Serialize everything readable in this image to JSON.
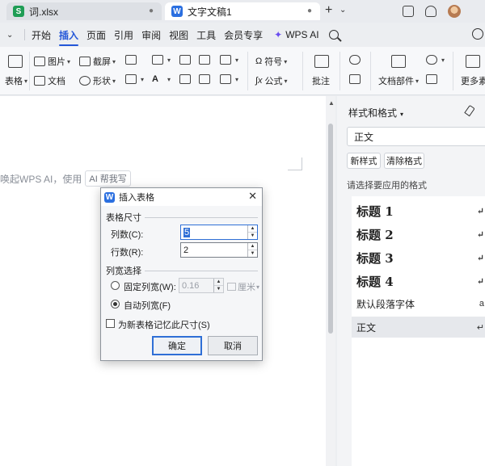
{
  "titlebar": {
    "tabs": [
      {
        "badge": "S",
        "label": "词.xlsx",
        "marker": "●"
      },
      {
        "badge": "W",
        "label": "文字文稿1",
        "marker": "●"
      }
    ],
    "new_tab": "+",
    "tab_list": "⌄"
  },
  "menubar": {
    "items": [
      "开始",
      "插入",
      "页面",
      "引用",
      "审阅",
      "视图",
      "工具",
      "会员专享"
    ],
    "active": "插入",
    "wps_ai": "WPS AI",
    "chevron": "⌄"
  },
  "ribbon": {
    "table": "表格",
    "picture": "图片",
    "screenshot": "截屏",
    "document": "文档",
    "shape": "形状",
    "symbol": "符号",
    "formula": "公式",
    "comment": "批注",
    "doc_parts": "文档部件",
    "more": "更多素"
  },
  "document": {
    "hint_text": "唤起WPS AI，使用",
    "ai_pill": "AI 帮我写"
  },
  "side_pane": {
    "title": "样式和格式",
    "current_style": "正文",
    "new_style_btn": "新样式",
    "clear_format_btn": "清除格式",
    "subtitle": "请选择要应用的格式",
    "styles": [
      {
        "label": "标题 1",
        "mark": "↵"
      },
      {
        "label": "标题 2",
        "mark": "↵"
      },
      {
        "label": "标题 3",
        "mark": "↵"
      },
      {
        "label": "标题 4",
        "mark": "↵"
      },
      {
        "label": "默认段落字体",
        "mark": "a"
      },
      {
        "label": "正文",
        "mark": "↵"
      }
    ]
  },
  "dialog": {
    "title": "插入表格",
    "close": "✕",
    "group_size": "表格尺寸",
    "cols_label": "列数(C):",
    "cols_value": "5",
    "rows_label": "行数(R):",
    "rows_value": "2",
    "group_width": "列宽选择",
    "fixed_width_label": "固定列宽(W):",
    "fixed_width_value": "0.16",
    "unit": "厘米",
    "auto_width_label": "自动列宽(F)",
    "remember_label": "为新表格记忆此尺寸(S)",
    "ok_btn": "确定",
    "cancel_btn": "取消",
    "auto_width_selected": true,
    "remember_checked": false
  }
}
